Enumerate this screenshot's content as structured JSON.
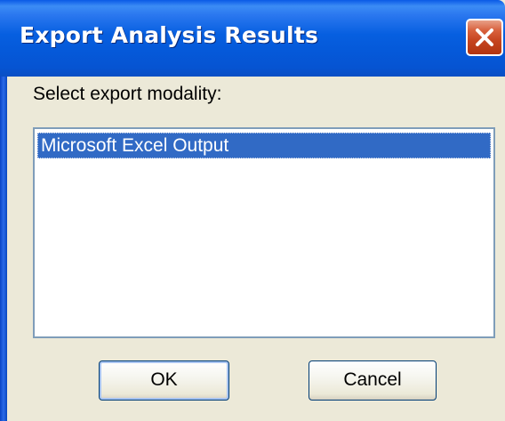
{
  "window": {
    "title": "Export Analysis Results",
    "close_icon": "close-x-icon"
  },
  "dialog": {
    "prompt": "Select export modality:",
    "list": {
      "items": [
        {
          "label": "Microsoft Excel Output",
          "selected": true
        }
      ]
    },
    "buttons": {
      "ok_label": "OK",
      "cancel_label": "Cancel"
    }
  },
  "colors": {
    "titlebar": "#0558d8",
    "dialog_background": "#ece9d8",
    "selection": "#316ac5",
    "close_button": "#c5441f"
  }
}
